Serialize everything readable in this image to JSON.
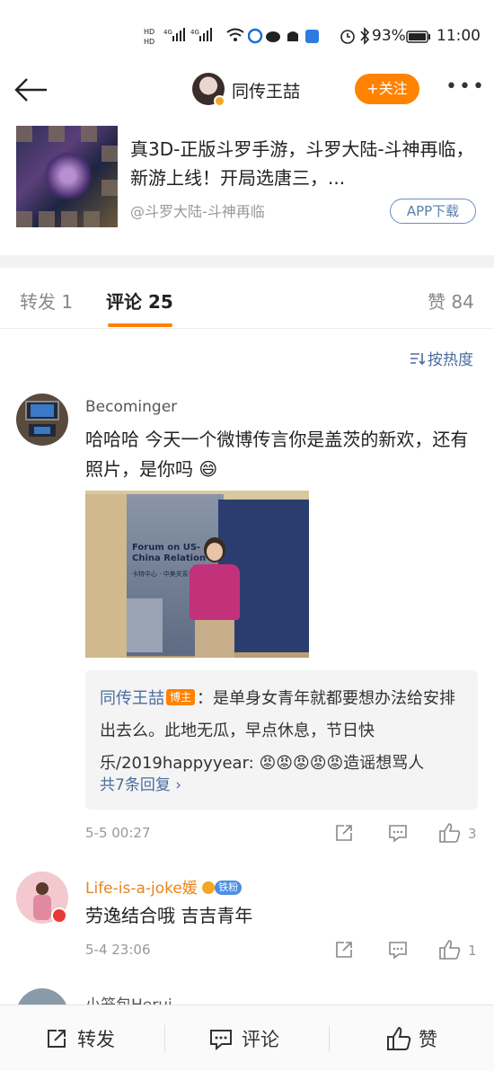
{
  "status_bar": {
    "signal_left": "HD 4G",
    "battery": "93%",
    "time": "11:00"
  },
  "nav": {
    "title": "同传王喆",
    "follow_label": "+关注",
    "more_label": "•••"
  },
  "ad": {
    "title": "真3D-正版斗罗手游，斗罗大陆-斗神再临，新游上线！开局选唐三，...",
    "source": "@斗罗大陆-斗神再临",
    "app_button": "APP下载"
  },
  "tabs": {
    "repost": "转发 1",
    "comments": "评论 25",
    "likes": "赞 84"
  },
  "sort_label": "按热度",
  "comments": [
    {
      "name": "Becominger",
      "text": "哈哈哈 今天一个微博传言你是盖茨的新欢，还有照片，是你吗 😄",
      "photo_banner": "Forum on US-China Relation",
      "photo_sub": "卡特中心 · 中美关系论坛",
      "reply": {
        "author": "同传王喆",
        "tag": "博主",
        "text": "：是单身女青年就都要想办法给安排出去么。此地无瓜，早点休息，节日快乐/2019happyyear: 😡😡😡😡😡造谣想骂人",
        "more": "共7条回复 ›"
      },
      "time": "5-5 00:27",
      "like_count": "3"
    },
    {
      "name": "Life-is-a-joke媛",
      "tag": "铁粉",
      "text": "劳逸结合哦 吉吉青年",
      "time": "5-4 23:06",
      "like_count": "1"
    },
    {
      "name": "小笼包Herui"
    }
  ],
  "bottom_bar": {
    "repost": "转发",
    "comment": "评论",
    "like": "赞"
  }
}
